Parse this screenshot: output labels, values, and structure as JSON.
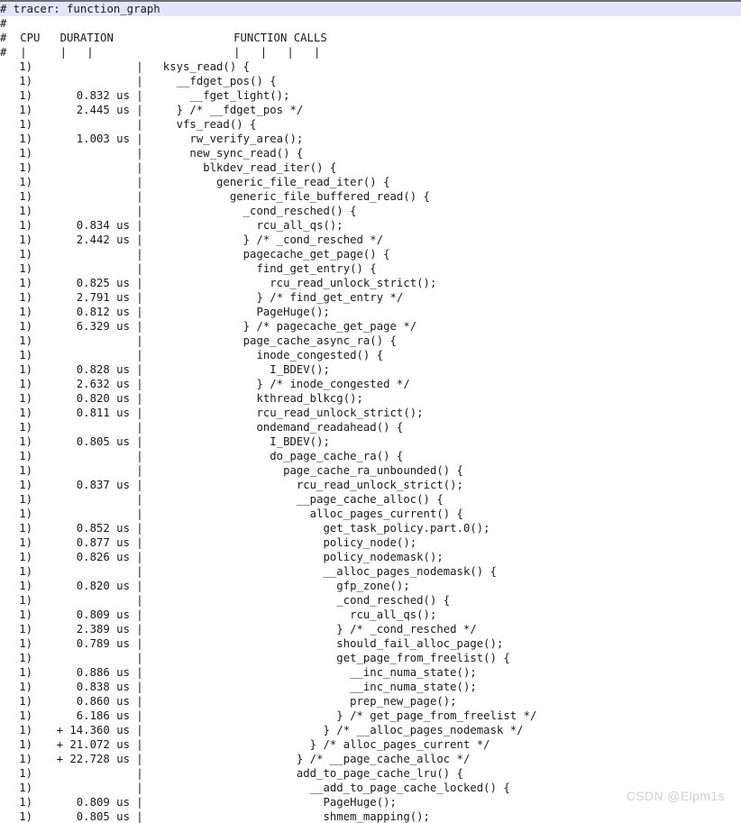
{
  "window": {
    "title": "ftrace function_graph trace output",
    "background_color": "#ffffff",
    "text_color": "#1a1a1a",
    "header_highlight_color": "#e3e5f9",
    "top_border_color": "#6f6f6f"
  },
  "header": {
    "tracer_line": "# tracer: function_graph",
    "blank_line": "#",
    "columns_line": "#  CPU   DURATION                  FUNCTION CALLS",
    "rule_line": "#  |     |   |                     |   |   |   |",
    "cpu_label": "CPU",
    "duration_label": "DURATION",
    "function_calls_label": "FUNCTION CALLS"
  },
  "watermark": {
    "text": "CSDN @Elpm1s",
    "color": "#cfcfcf"
  },
  "trace_rows": [
    {
      "cpu": "1)",
      "duration": "",
      "bar": "|",
      "fn": "  ksys_read() {"
    },
    {
      "cpu": "1)",
      "duration": "",
      "bar": "|",
      "fn": "    __fdget_pos() {"
    },
    {
      "cpu": "1)",
      "duration": "0.832 us",
      "bar": "|",
      "fn": "      __fget_light();"
    },
    {
      "cpu": "1)",
      "duration": "2.445 us",
      "bar": "|",
      "fn": "    } /* __fdget_pos */"
    },
    {
      "cpu": "1)",
      "duration": "",
      "bar": "|",
      "fn": "    vfs_read() {"
    },
    {
      "cpu": "1)",
      "duration": "1.003 us",
      "bar": "|",
      "fn": "      rw_verify_area();"
    },
    {
      "cpu": "1)",
      "duration": "",
      "bar": "|",
      "fn": "      new_sync_read() {"
    },
    {
      "cpu": "1)",
      "duration": "",
      "bar": "|",
      "fn": "        blkdev_read_iter() {"
    },
    {
      "cpu": "1)",
      "duration": "",
      "bar": "|",
      "fn": "          generic_file_read_iter() {"
    },
    {
      "cpu": "1)",
      "duration": "",
      "bar": "|",
      "fn": "            generic_file_buffered_read() {"
    },
    {
      "cpu": "1)",
      "duration": "",
      "bar": "|",
      "fn": "              _cond_resched() {"
    },
    {
      "cpu": "1)",
      "duration": "0.834 us",
      "bar": "|",
      "fn": "                rcu_all_qs();"
    },
    {
      "cpu": "1)",
      "duration": "2.442 us",
      "bar": "|",
      "fn": "              } /* _cond_resched */"
    },
    {
      "cpu": "1)",
      "duration": "",
      "bar": "|",
      "fn": "              pagecache_get_page() {"
    },
    {
      "cpu": "1)",
      "duration": "",
      "bar": "|",
      "fn": "                find_get_entry() {"
    },
    {
      "cpu": "1)",
      "duration": "0.825 us",
      "bar": "|",
      "fn": "                  rcu_read_unlock_strict();"
    },
    {
      "cpu": "1)",
      "duration": "2.791 us",
      "bar": "|",
      "fn": "                } /* find_get_entry */"
    },
    {
      "cpu": "1)",
      "duration": "0.812 us",
      "bar": "|",
      "fn": "                PageHuge();"
    },
    {
      "cpu": "1)",
      "duration": "6.329 us",
      "bar": "|",
      "fn": "              } /* pagecache_get_page */"
    },
    {
      "cpu": "1)",
      "duration": "",
      "bar": "|",
      "fn": "              page_cache_async_ra() {"
    },
    {
      "cpu": "1)",
      "duration": "",
      "bar": "|",
      "fn": "                inode_congested() {"
    },
    {
      "cpu": "1)",
      "duration": "0.828 us",
      "bar": "|",
      "fn": "                  I_BDEV();"
    },
    {
      "cpu": "1)",
      "duration": "2.632 us",
      "bar": "|",
      "fn": "                } /* inode_congested */"
    },
    {
      "cpu": "1)",
      "duration": "0.820 us",
      "bar": "|",
      "fn": "                kthread_blkcg();"
    },
    {
      "cpu": "1)",
      "duration": "0.811 us",
      "bar": "|",
      "fn": "                rcu_read_unlock_strict();"
    },
    {
      "cpu": "1)",
      "duration": "",
      "bar": "|",
      "fn": "                ondemand_readahead() {"
    },
    {
      "cpu": "1)",
      "duration": "0.805 us",
      "bar": "|",
      "fn": "                  I_BDEV();"
    },
    {
      "cpu": "1)",
      "duration": "",
      "bar": "|",
      "fn": "                  do_page_cache_ra() {"
    },
    {
      "cpu": "1)",
      "duration": "",
      "bar": "|",
      "fn": "                    page_cache_ra_unbounded() {"
    },
    {
      "cpu": "1)",
      "duration": "0.837 us",
      "bar": "|",
      "fn": "                      rcu_read_unlock_strict();"
    },
    {
      "cpu": "1)",
      "duration": "",
      "bar": "|",
      "fn": "                      __page_cache_alloc() {"
    },
    {
      "cpu": "1)",
      "duration": "",
      "bar": "|",
      "fn": "                        alloc_pages_current() {"
    },
    {
      "cpu": "1)",
      "duration": "0.852 us",
      "bar": "|",
      "fn": "                          get_task_policy.part.0();"
    },
    {
      "cpu": "1)",
      "duration": "0.877 us",
      "bar": "|",
      "fn": "                          policy_node();"
    },
    {
      "cpu": "1)",
      "duration": "0.826 us",
      "bar": "|",
      "fn": "                          policy_nodemask();"
    },
    {
      "cpu": "1)",
      "duration": "",
      "bar": "|",
      "fn": "                          __alloc_pages_nodemask() {"
    },
    {
      "cpu": "1)",
      "duration": "0.820 us",
      "bar": "|",
      "fn": "                            gfp_zone();"
    },
    {
      "cpu": "1)",
      "duration": "",
      "bar": "|",
      "fn": "                            _cond_resched() {"
    },
    {
      "cpu": "1)",
      "duration": "0.809 us",
      "bar": "|",
      "fn": "                              rcu_all_qs();"
    },
    {
      "cpu": "1)",
      "duration": "2.389 us",
      "bar": "|",
      "fn": "                            } /* _cond_resched */"
    },
    {
      "cpu": "1)",
      "duration": "0.789 us",
      "bar": "|",
      "fn": "                            should_fail_alloc_page();"
    },
    {
      "cpu": "1)",
      "duration": "",
      "bar": "|",
      "fn": "                            get_page_from_freelist() {"
    },
    {
      "cpu": "1)",
      "duration": "0.886 us",
      "bar": "|",
      "fn": "                              __inc_numa_state();"
    },
    {
      "cpu": "1)",
      "duration": "0.838 us",
      "bar": "|",
      "fn": "                              __inc_numa_state();"
    },
    {
      "cpu": "1)",
      "duration": "0.860 us",
      "bar": "|",
      "fn": "                              prep_new_page();"
    },
    {
      "cpu": "1)",
      "duration": "6.186 us",
      "bar": "|",
      "fn": "                            } /* get_page_from_freelist */"
    },
    {
      "cpu": "1)",
      "duration": "+ 14.360 us",
      "bar": "|",
      "fn": "                          } /* __alloc_pages_nodemask */"
    },
    {
      "cpu": "1)",
      "duration": "+ 21.072 us",
      "bar": "|",
      "fn": "                        } /* alloc_pages_current */"
    },
    {
      "cpu": "1)",
      "duration": "+ 22.728 us",
      "bar": "|",
      "fn": "                      } /* __page_cache_alloc */"
    },
    {
      "cpu": "1)",
      "duration": "",
      "bar": "|",
      "fn": "                      add_to_page_cache_lru() {"
    },
    {
      "cpu": "1)",
      "duration": "",
      "bar": "|",
      "fn": "                        __add_to_page_cache_locked() {"
    },
    {
      "cpu": "1)",
      "duration": "0.809 us",
      "bar": "|",
      "fn": "                          PageHuge();"
    },
    {
      "cpu": "1)",
      "duration": "0.805 us",
      "bar": "|",
      "fn": "                          shmem_mapping();"
    }
  ]
}
